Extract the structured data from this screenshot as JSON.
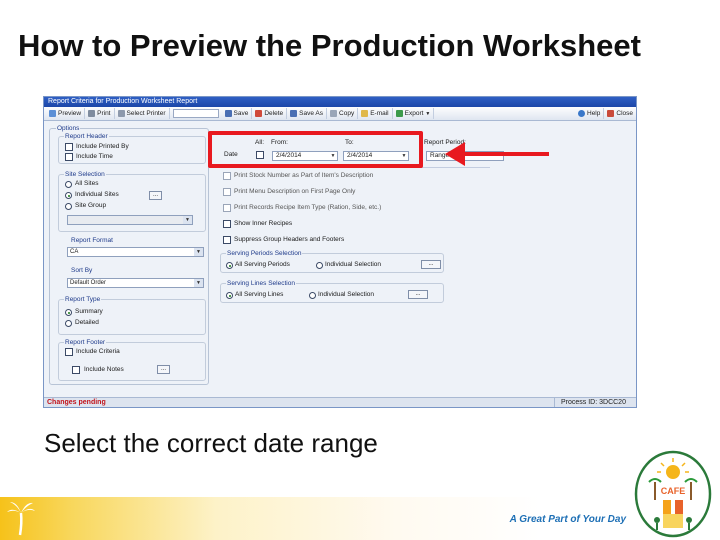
{
  "slide": {
    "title": "How to Preview the Production Worksheet",
    "caption": "Select the correct date range",
    "tagline": "A Great Part of Your Day",
    "logo_text": "CAFE"
  },
  "window": {
    "title": "Report Criteria for Production Worksheet Report",
    "toolbar": {
      "preview": "Preview",
      "print": "Print",
      "select_printer": "Select Printer",
      "save": "Save",
      "delete": "Delete",
      "save_as": "Save As",
      "copy": "Copy",
      "email": "E-mail",
      "export": "Export",
      "help": "Help",
      "close": "Close"
    },
    "status": {
      "left": "Changes pending",
      "right": "Process ID: 3DCC20"
    }
  },
  "options": {
    "group_label": "Options",
    "report_header": {
      "label": "Report Header",
      "include_printed_by": "Include Printed By",
      "include_time": "Include Time"
    },
    "site_selection": {
      "label": "Site Selection",
      "all_sites": "All Sites",
      "individual_sites": "Individual Sites",
      "site_group": "Site Group",
      "dots": "..."
    },
    "report_format": {
      "label": "Report Format",
      "value": "CA"
    },
    "sort_by": {
      "label": "Sort By",
      "value": "Default Order"
    },
    "report_type": {
      "label": "Report Type",
      "summary": "Summary",
      "detailed": "Detailed"
    },
    "report_footer": {
      "label": "Report Footer",
      "include_criteria": "Include Criteria",
      "include_notes": "Include Notes",
      "dots": "..."
    }
  },
  "dates": {
    "all_label": "All:",
    "from_label": "From:",
    "to_label": "To:",
    "date_label": "Date",
    "from_value": "2/4/2014",
    "to_value": "2/4/2014",
    "report_period_label": "Report Period:",
    "report_period_value": "Range"
  },
  "checks": {
    "print_stock_number": "Print Stock Number as Part of Item's Description",
    "print_menu_description": "Print Menu Description on First Page Only",
    "print_records_recipe": "Print Records Recipe Item Type (Ration, Side, etc.)",
    "show_inner_recipes": "Show Inner Recipes",
    "suppress_group_headers": "Suppress Group Headers and Footers"
  },
  "serving_periods": {
    "label": "Serving Periods Selection",
    "all": "All Serving Periods",
    "individual": "Individual Selection",
    "dots": "..."
  },
  "serving_lines": {
    "label": "Serving Lines Selection",
    "all": "All Serving Lines",
    "individual": "Individual Selection",
    "dots": "..."
  },
  "colors": {
    "highlight": "#e8191f",
    "title_bar": "#1c46a8",
    "status_text": "#c2141b",
    "tagline": "#1d6fb5"
  }
}
